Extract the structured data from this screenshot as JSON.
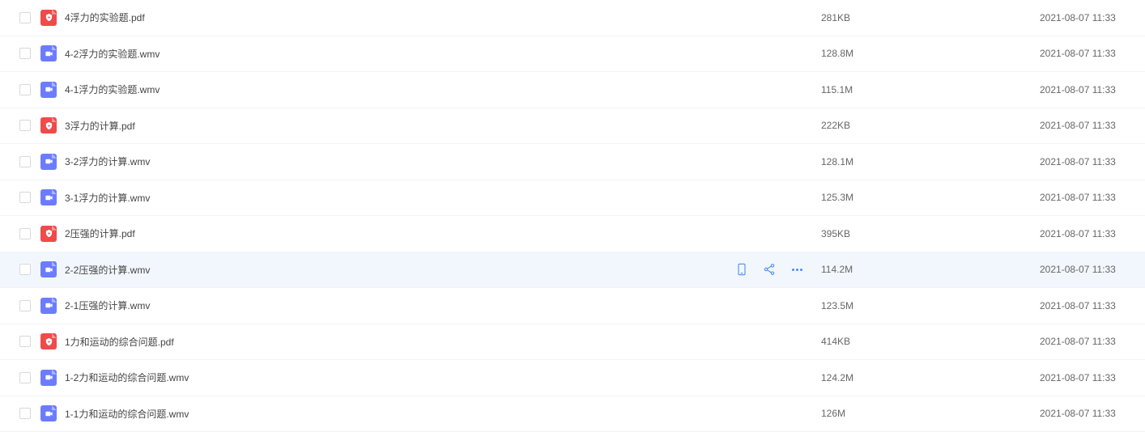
{
  "hovered_index": 7,
  "files": [
    {
      "name": "4浮力的实验题.pdf",
      "type": "pdf",
      "size": "281KB",
      "date": "2021-08-07 11:33"
    },
    {
      "name": "4-2浮力的实验题.wmv",
      "type": "video",
      "size": "128.8M",
      "date": "2021-08-07 11:33"
    },
    {
      "name": "4-1浮力的实验题.wmv",
      "type": "video",
      "size": "115.1M",
      "date": "2021-08-07 11:33"
    },
    {
      "name": "3浮力的计算.pdf",
      "type": "pdf",
      "size": "222KB",
      "date": "2021-08-07 11:33"
    },
    {
      "name": "3-2浮力的计算.wmv",
      "type": "video",
      "size": "128.1M",
      "date": "2021-08-07 11:33"
    },
    {
      "name": "3-1浮力的计算.wmv",
      "type": "video",
      "size": "125.3M",
      "date": "2021-08-07 11:33"
    },
    {
      "name": "2压强的计算.pdf",
      "type": "pdf",
      "size": "395KB",
      "date": "2021-08-07 11:33"
    },
    {
      "name": "2-2压强的计算.wmv",
      "type": "video",
      "size": "114.2M",
      "date": "2021-08-07 11:33"
    },
    {
      "name": "2-1压强的计算.wmv",
      "type": "video",
      "size": "123.5M",
      "date": "2021-08-07 11:33"
    },
    {
      "name": "1力和运动的综合问题.pdf",
      "type": "pdf",
      "size": "414KB",
      "date": "2021-08-07 11:33"
    },
    {
      "name": "1-2力和运动的综合问题.wmv",
      "type": "video",
      "size": "124.2M",
      "date": "2021-08-07 11:33"
    },
    {
      "name": "1-1力和运动的综合问题.wmv",
      "type": "video",
      "size": "126M",
      "date": "2021-08-07 11:33"
    }
  ]
}
